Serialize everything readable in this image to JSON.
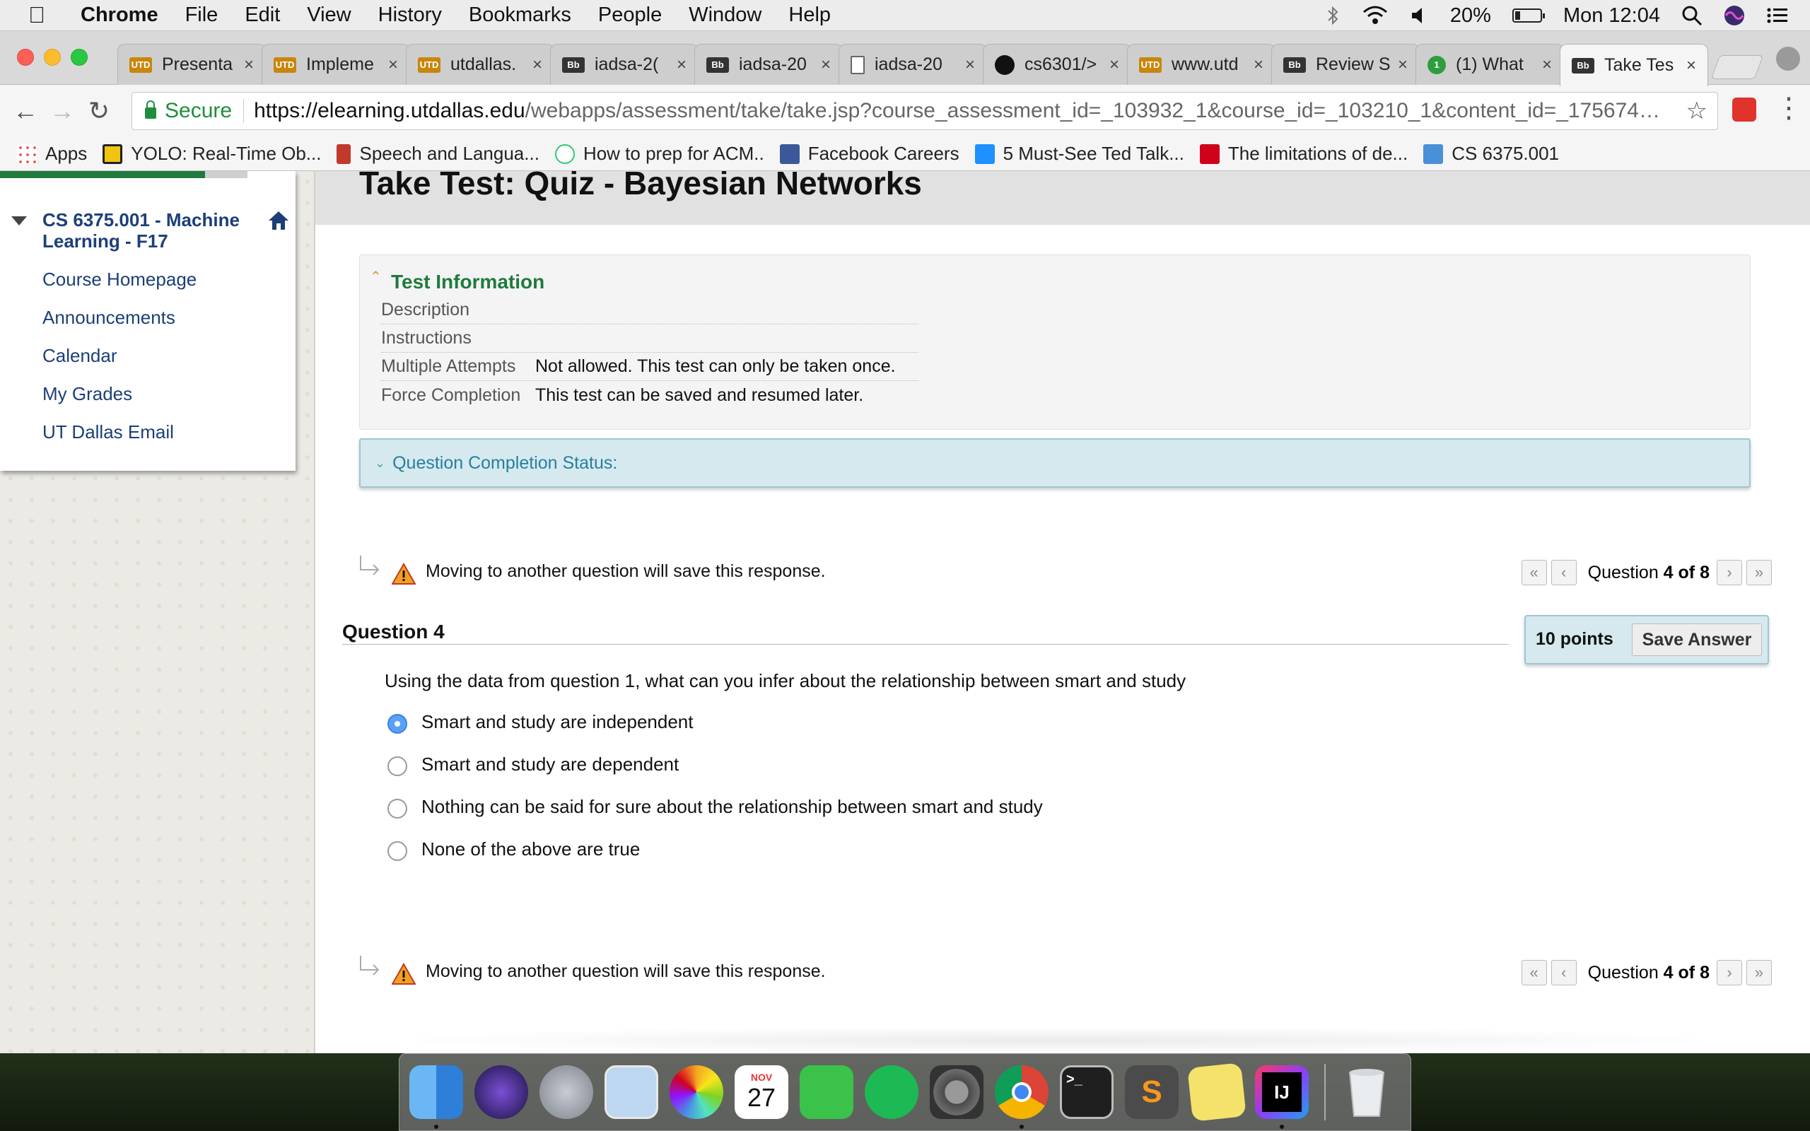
{
  "menubar": {
    "app": "Chrome",
    "items": [
      "File",
      "Edit",
      "View",
      "History",
      "Bookmarks",
      "People",
      "Window",
      "Help"
    ],
    "battery": "20%",
    "clock": "Mon 12:04"
  },
  "tabs": [
    {
      "title": "Presenta",
      "favicon": "utd"
    },
    {
      "title": "Impleme",
      "favicon": "utd"
    },
    {
      "title": "utdallas.",
      "favicon": "utd"
    },
    {
      "title": "iadsa-2(",
      "favicon": "bb"
    },
    {
      "title": "iadsa-20",
      "favicon": "bb"
    },
    {
      "title": "iadsa-20",
      "favicon": "doc"
    },
    {
      "title": "cs6301/>",
      "favicon": "github"
    },
    {
      "title": "www.utd",
      "favicon": "utd"
    },
    {
      "title": "Review S",
      "favicon": "bb"
    },
    {
      "title": "(1) What",
      "favicon": "quora",
      "badge": "1"
    },
    {
      "title": "Take Tes",
      "favicon": "bb",
      "active": true
    }
  ],
  "toolbar": {
    "secure_label": "Secure",
    "url_host": "https://elearning.utdallas.edu",
    "url_path": "/webapps/assessment/take/take.jsp?course_assessment_id=_103932_1&course_id=_103210_1&content_id=_1756748_1&questi..."
  },
  "bookmarks": [
    {
      "label": "Apps",
      "color": "#4285f4"
    },
    {
      "label": "YOLO: Real-Time Ob...",
      "color": "#f1c40f"
    },
    {
      "label": "Speech and Langua...",
      "color": "#c0392b"
    },
    {
      "label": "How to prep for ACM..",
      "color": "#2ecc71"
    },
    {
      "label": "Facebook Careers",
      "color": "#3b5998"
    },
    {
      "label": "5 Must-See Ted Talk...",
      "color": "#1e90ff"
    },
    {
      "label": "The limitations of de...",
      "color": "#d0021b"
    },
    {
      "label": "CS 6375.001",
      "color": "#4a90d9"
    }
  ],
  "sidebar": {
    "course_title": "CS 6375.001 - Machine Learning - F17",
    "links": [
      "Course Homepage",
      "Announcements",
      "Calendar",
      "My Grades",
      "UT Dallas Email"
    ]
  },
  "test": {
    "page_title": "Take Test: Quiz - Bayesian Networks",
    "info_title": "Test Information",
    "info_rows": [
      {
        "key": "Description",
        "value": ""
      },
      {
        "key": "Instructions",
        "value": ""
      },
      {
        "key": "Multiple Attempts",
        "value": "Not allowed. This test can only be taken once."
      },
      {
        "key": "Force Completion",
        "value": "This test can be saved and resumed later."
      }
    ],
    "completion_status": "Question Completion Status:",
    "save_warning": "Moving to another question will save this response.",
    "pager": {
      "prefix": "Question",
      "current": "4",
      "of": "of",
      "total": "8"
    },
    "question_label": "Question 4",
    "points": "10 points",
    "save_answer": "Save Answer",
    "question_text": "Using the data from question 1, what can you infer about the relationship between smart and study",
    "options": [
      {
        "label": "Smart and study are independent",
        "selected": true
      },
      {
        "label": "Smart and study are dependent",
        "selected": false
      },
      {
        "label": "Nothing can be said for sure about the relationship between smart and study",
        "selected": false
      },
      {
        "label": "None of the above are true",
        "selected": false
      }
    ]
  },
  "dock": {
    "apps": [
      {
        "name": "finder-icon",
        "color": "#3d8fe0"
      },
      {
        "name": "siri-icon",
        "color": "#222244"
      },
      {
        "name": "launchpad-icon",
        "color": "#8a8f99"
      },
      {
        "name": "mail-icon",
        "color": "#6fa8dc"
      },
      {
        "name": "photos-icon",
        "color": "#f4f4f4"
      },
      {
        "name": "calendar-icon",
        "color": "#ffffff",
        "month": "NOV",
        "day": "27"
      },
      {
        "name": "facetime-icon",
        "color": "#3ac24a"
      },
      {
        "name": "spotify-icon",
        "color": "#1db954"
      },
      {
        "name": "system-preferences-icon",
        "color": "#6d6d6d"
      },
      {
        "name": "chrome-icon",
        "color": "#db4437"
      },
      {
        "name": "terminal-icon",
        "color": "#222222",
        "text": ">_"
      },
      {
        "name": "sublime-text-icon",
        "color": "#4b4b4b",
        "text": "S"
      },
      {
        "name": "stickies-icon",
        "color": "#f5e26b"
      },
      {
        "name": "intellij-icon",
        "color": "#000000",
        "text": "IJ"
      }
    ]
  }
}
